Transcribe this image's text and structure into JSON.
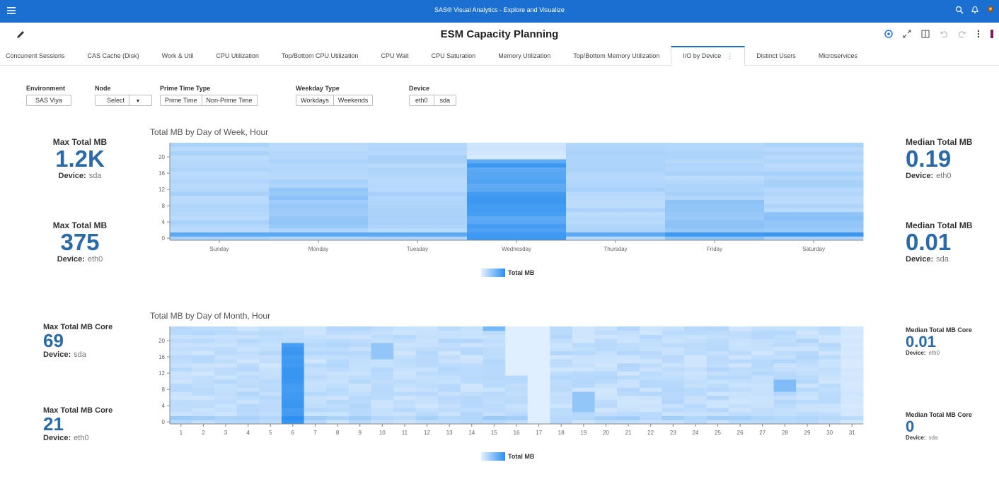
{
  "app": {
    "title": "SAS® Visual Analytics - Explore and Visualize",
    "report_title": "ESM Capacity Planning"
  },
  "tabs": [
    {
      "label": "Concurrent Sessions"
    },
    {
      "label": "CAS Cache (Disk)"
    },
    {
      "label": "Work & Util"
    },
    {
      "label": "CPU Utilization"
    },
    {
      "label": "Top/Bottom CPU Utilization"
    },
    {
      "label": "CPU Wait"
    },
    {
      "label": "CPU Saturation"
    },
    {
      "label": "Memory Utilization"
    },
    {
      "label": "Top/Bottom Memory Utilization"
    },
    {
      "label": "I/O by Device",
      "active": true
    },
    {
      "label": "Distinct Users"
    },
    {
      "label": "Microservices"
    }
  ],
  "filters": {
    "environment": {
      "label": "Environment",
      "value": "SAS Viya"
    },
    "node": {
      "label": "Node",
      "value": "Select"
    },
    "prime_time": {
      "label": "Prime Time Type",
      "options": [
        "Prime Time",
        "Non-Prime Time"
      ]
    },
    "weekday": {
      "label": "Weekday Type",
      "options": [
        "Workdays",
        "Weekends"
      ]
    },
    "device": {
      "label": "Device",
      "options": [
        "eth0",
        "sda"
      ]
    }
  },
  "kpis": {
    "k1": {
      "label": "Max Total MB",
      "value": "1.2K",
      "device_label": "Device:",
      "device": "sda"
    },
    "k2": {
      "label": "Max Total MB",
      "value": "375",
      "device_label": "Device:",
      "device": "eth0"
    },
    "k3": {
      "label": "Max Total MB Core",
      "value": "69",
      "device_label": "Device:",
      "device": "sda"
    },
    "k4": {
      "label": "Max Total MB Core",
      "value": "21",
      "device_label": "Device:",
      "device": "eth0"
    },
    "k5": {
      "label": "Median Total MB",
      "value": "0.19",
      "device_label": "Device:",
      "device": "eth0"
    },
    "k6": {
      "label": "Median Total MB",
      "value": "0.01",
      "device_label": "Device:",
      "device": "sda"
    },
    "k7": {
      "label": "Median Total MB Core",
      "value": "0.01",
      "device_label": "Device:",
      "device": "eth0"
    },
    "k8": {
      "label": "Median Total MB Core",
      "value": "0",
      "device_label": "Device:",
      "device": "sda"
    }
  },
  "chart_data": [
    {
      "type": "heatmap",
      "title": "Total MB by Day of Week, Hour",
      "x_categories": [
        "Sunday",
        "Monday",
        "Tuesday",
        "Wednesday",
        "Thursday",
        "Friday",
        "Saturday"
      ],
      "y_ticks": [
        0,
        4,
        8,
        12,
        16,
        20
      ],
      "y_range": [
        0,
        23
      ],
      "legend": "Total MB",
      "color_low": "#e6f2ff",
      "color_high": "#2c8ff0",
      "grid": false,
      "legend_position": "bottom"
    },
    {
      "type": "heatmap",
      "title": "Total MB by Day of Month, Hour",
      "x_categories": [
        "1",
        "2",
        "3",
        "4",
        "5",
        "6",
        "7",
        "8",
        "9",
        "10",
        "11",
        "12",
        "13",
        "14",
        "15",
        "16",
        "17",
        "18",
        "19",
        "20",
        "21",
        "22",
        "23",
        "24",
        "25",
        "26",
        "27",
        "28",
        "29",
        "30",
        "31"
      ],
      "y_ticks": [
        0,
        4,
        8,
        12,
        16,
        20
      ],
      "y_range": [
        0,
        23
      ],
      "legend": "Total MB",
      "color_low": "#e6f2ff",
      "color_high": "#2c8ff0",
      "grid": false,
      "legend_position": "bottom"
    }
  ]
}
